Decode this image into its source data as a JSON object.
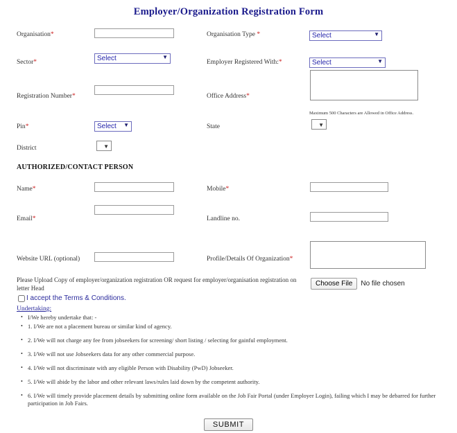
{
  "form": {
    "title": "Employer/Organization Registration Form",
    "fields": {
      "organisation_label": "Organisation*",
      "organisation_value": "",
      "organisation_type_label": "Organisation Type *",
      "organisation_type_value": "Select",
      "sector_label": "Sector*",
      "sector_value": "Select",
      "employer_registered_with_label": "Employer Registered With:*",
      "employer_registered_with_value": "Select",
      "registration_number_label": "Registration Number*",
      "registration_number_value": "",
      "office_address_label": "Office Address*",
      "office_address_value": "",
      "office_address_hint": "Maximum 500 Characters are Allowed in Office Address.",
      "pin_label": "Pin*",
      "pin_value": "Select",
      "state_label": "State",
      "state_value": "",
      "district_label": "District",
      "district_value": ""
    },
    "contact_section": {
      "heading": "AUTHORIZED/CONTACT PERSON",
      "name_label": "Name*",
      "name_value": "",
      "mobile_label": "Mobile*",
      "mobile_value": "",
      "email_label": "Email*",
      "email_value": "",
      "landline_label": "Landline no.",
      "landline_value": "",
      "website_label": "Website URL (optional)",
      "website_value": "",
      "profile_label": "Profile/Details Of Organization*",
      "profile_value": ""
    },
    "upload": {
      "note": "Please Upload Copy of employer/organization registration OR request for employer/organisation registration on letter Head",
      "choose_file_label": "Choose File",
      "no_file_text": "No file chosen"
    },
    "terms": {
      "accept_text": "I accept the Terms & Conditions.",
      "checked": false
    },
    "undertaking": {
      "title": "Undertaking:",
      "items": [
        "I/We hereby undertake that: -",
        "1. I/We are not a placement bureau or similar kind of agency.",
        "2. I/We will not charge any fee from jobseekers for screening/ short listing / selecting for gainful employment.",
        "3. I/We will not use Jobseekers data for any other commercial purpose.",
        "4. I/We will not discriminate with any eligible Person with Disability (PwD) Jobseeker.",
        "5. I/We will abide by the labor and other relevant laws/rules laid down by the competent authority.",
        "6. I/We will timely provide placement details by submitting online form available on the Job Fair Portal (under Employer Login), failing which I may be debarred for further participation in Job Fairs."
      ]
    },
    "submit_label": "SUBMIT",
    "colors": {
      "title": "#1a1a8c",
      "select_text": "#2222aa",
      "link": "#2a2a9c",
      "required": "#cc2222"
    }
  }
}
